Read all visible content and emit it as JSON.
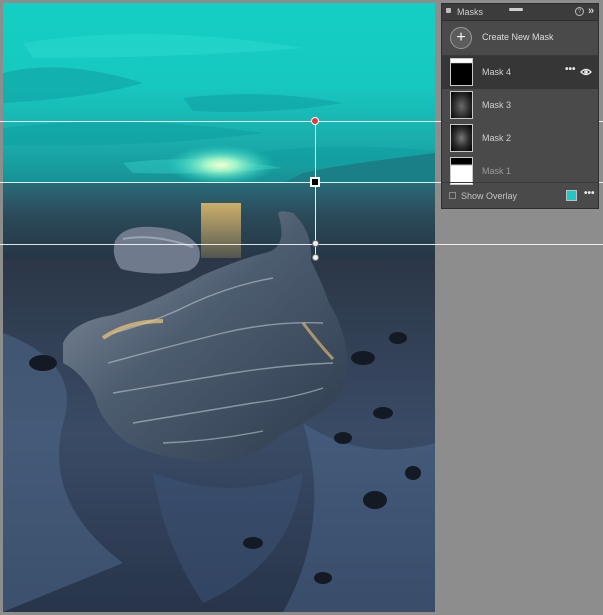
{
  "panel": {
    "title": "Masks",
    "help_glyph": "?",
    "collapse_glyph": "»",
    "create_plus": "+",
    "create_label": "Create New Mask",
    "masks": [
      {
        "name": "Mask 4",
        "selected": true,
        "thumb": "linear-gradient-top"
      },
      {
        "name": "Mask 3",
        "selected": false,
        "thumb": "radial-soft"
      },
      {
        "name": "Mask 2",
        "selected": false,
        "thumb": "radial-soft"
      },
      {
        "name": "Mask 1",
        "selected": false,
        "thumb": "linear-gradient-bottom"
      }
    ],
    "more_glyph": "•••",
    "overlay_label": "Show Overlay",
    "overlay_checked": false,
    "overlay_color": "#1fc7c7"
  },
  "icons": {
    "panel_grip": "grip-icon",
    "help": "help-icon",
    "collapse": "collapse-icon",
    "create": "plus-icon",
    "visibility": "eye-icon",
    "more": "more-icon"
  },
  "colors": {
    "sky": "#19d3c9",
    "workspace": "#8d8d8d",
    "panel_bg": "#4a4a4a",
    "selection_pin": "#e23b3b"
  }
}
